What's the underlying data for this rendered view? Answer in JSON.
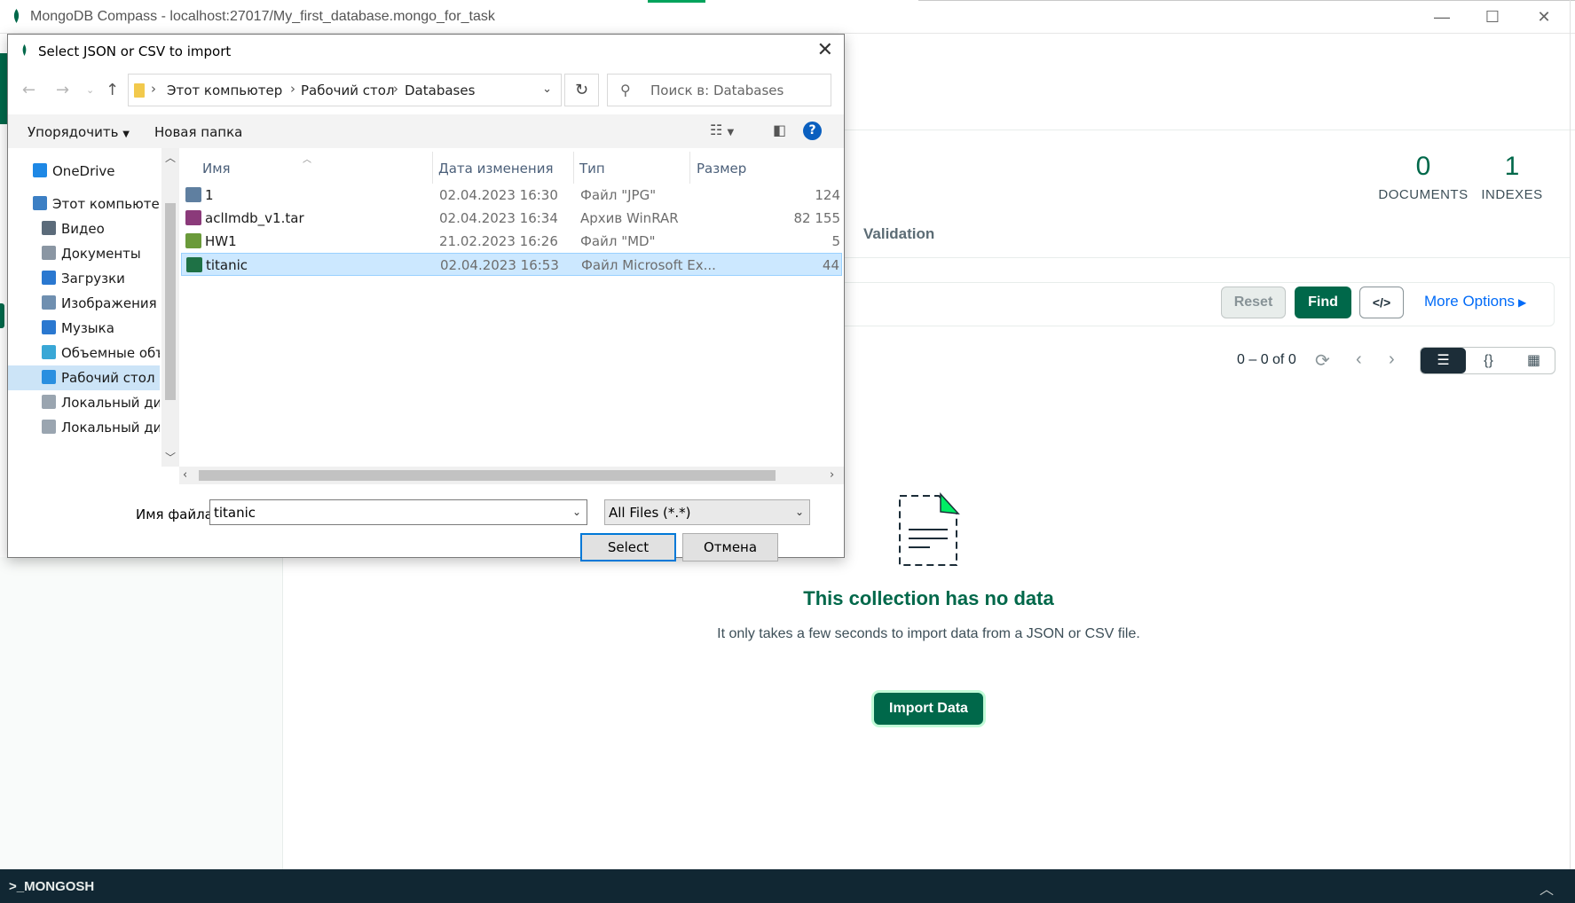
{
  "compass": {
    "window_title": "MongoDB Compass - localhost:27017/My_first_database.mongo_for_task",
    "win_controls": {
      "minimize": "—",
      "maximize": "☐",
      "close": "✕"
    },
    "stats": [
      {
        "value": "0",
        "label": "DOCUMENTS"
      },
      {
        "value": "1",
        "label": "INDEXES"
      }
    ],
    "tab_validation": "Validation",
    "query": {
      "reset_label": "Reset",
      "find_label": "Find",
      "code_label": "</>",
      "more_options_label": "More Options"
    },
    "pager": {
      "range": "0 – 0 of 0"
    },
    "empty_state": {
      "title": "This collection has no data",
      "description": "It only takes a few seconds to import data from a JSON or CSV file.",
      "import_label": "Import Data"
    },
    "shell_label": ">_MONGOSH"
  },
  "dialog": {
    "title": "Select JSON or CSV to import",
    "breadcrumb": [
      "Этот компьютер",
      "Рабочий стол",
      "Databases"
    ],
    "search_placeholder": "Поиск в: Databases",
    "organize_label": "Упорядочить",
    "new_folder_label": "Новая папка",
    "help_label": "?",
    "nav_items": [
      {
        "label": "OneDrive",
        "icon": "cloud-icon",
        "color": "#1e88e5"
      },
      {
        "label": "Этот компьютер",
        "icon": "computer-icon",
        "color": "#3c7fc4"
      },
      {
        "label": "Видео",
        "icon": "video-icon",
        "color": "#5b6b7a"
      },
      {
        "label": "Документы",
        "icon": "documents-icon",
        "color": "#8a96a3"
      },
      {
        "label": "Загрузки",
        "icon": "downloads-icon",
        "color": "#2a78d0"
      },
      {
        "label": "Изображения",
        "icon": "pictures-icon",
        "color": "#6f8fb0"
      },
      {
        "label": "Музыка",
        "icon": "music-icon",
        "color": "#2a78d0"
      },
      {
        "label": "Объемные объ",
        "icon": "3d-objects-icon",
        "color": "#39a7d6"
      },
      {
        "label": "Рабочий стол",
        "icon": "desktop-icon",
        "color": "#2a8fe0"
      },
      {
        "label": "Локальный дис",
        "icon": "local-disk-icon",
        "color": "#9aa5b0"
      },
      {
        "label": "Локальный дис",
        "icon": "local-disk-icon",
        "color": "#9aa5b0"
      }
    ],
    "columns": {
      "name": "Имя",
      "date": "Дата изменения",
      "type": "Тип",
      "size": "Размер"
    },
    "files": [
      {
        "name": "1",
        "date": "02.04.2023 16:30",
        "type": "Файл \"JPG\"",
        "size": "124",
        "icon": "image-file-icon",
        "color": "#5f7fa0"
      },
      {
        "name": "aclImdb_v1.tar",
        "date": "02.04.2023 16:34",
        "type": "Архив WinRAR",
        "size": "82 155",
        "icon": "winrar-archive-icon",
        "color": "#8b3a7a"
      },
      {
        "name": "HW1",
        "date": "21.02.2023 16:26",
        "type": "Файл \"MD\"",
        "size": "5",
        "icon": "md-file-icon",
        "color": "#6a9a3a"
      },
      {
        "name": "titanic",
        "date": "02.04.2023 16:53",
        "type": "Файл Microsoft Ex...",
        "size": "44",
        "icon": "excel-file-icon",
        "color": "#1e7145"
      }
    ],
    "selected_file_index": 3,
    "filename_label": "Имя файла:",
    "filename_value": "titanic",
    "filetype_value": "All Files (*.*)",
    "select_label": "Select",
    "cancel_label": "Отмена"
  },
  "colors": {
    "brand_green": "#00684a",
    "link_blue": "#016bf8",
    "shell_bg": "#112733",
    "selection_blue": "#cce8ff"
  }
}
